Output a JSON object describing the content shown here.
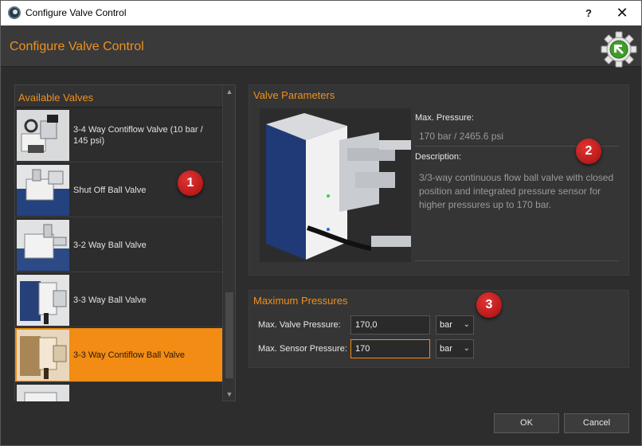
{
  "window": {
    "title": "Configure Valve Control",
    "help_glyph": "?",
    "close_glyph": "✕"
  },
  "header": {
    "title": "Configure Valve Control",
    "icon": "gear-arrow-icon"
  },
  "valve_list": {
    "title": "Available Valves",
    "items": [
      {
        "label": "3-4 Way Contiflow Valve (10 bar / 145 psi)",
        "selected": false
      },
      {
        "label": "Shut Off Ball Valve",
        "selected": false
      },
      {
        "label": "3-2 Way Ball Valve",
        "selected": false
      },
      {
        "label": "3-3 Way Ball Valve",
        "selected": false
      },
      {
        "label": "3-3 Way Contiflow Ball Valve",
        "selected": true
      },
      {
        "label": "",
        "selected": false
      }
    ]
  },
  "badges": [
    "1",
    "2",
    "3"
  ],
  "valve_parameters": {
    "title": "Valve Parameters",
    "max_pressure_label": "Max. Pressure:",
    "max_pressure_value": "170 bar / 2465.6 psi",
    "description_label": "Description:",
    "description_value": "3/3-way continuous flow ball valve with closed position and integrated pressure sensor for higher pressures up to 170 bar."
  },
  "maximum_pressures": {
    "title": "Maximum Pressures",
    "valve_label": "Max. Valve Pressure:",
    "valve_value": "170,0",
    "valve_unit": "bar",
    "sensor_label": "Max. Sensor Pressure:",
    "sensor_value": "170",
    "sensor_unit": "bar"
  },
  "footer": {
    "ok_label": "OK",
    "cancel_label": "Cancel"
  },
  "colors": {
    "accent": "#f28c14",
    "badge": "#c81e1e",
    "background": "#2d2d2d"
  }
}
